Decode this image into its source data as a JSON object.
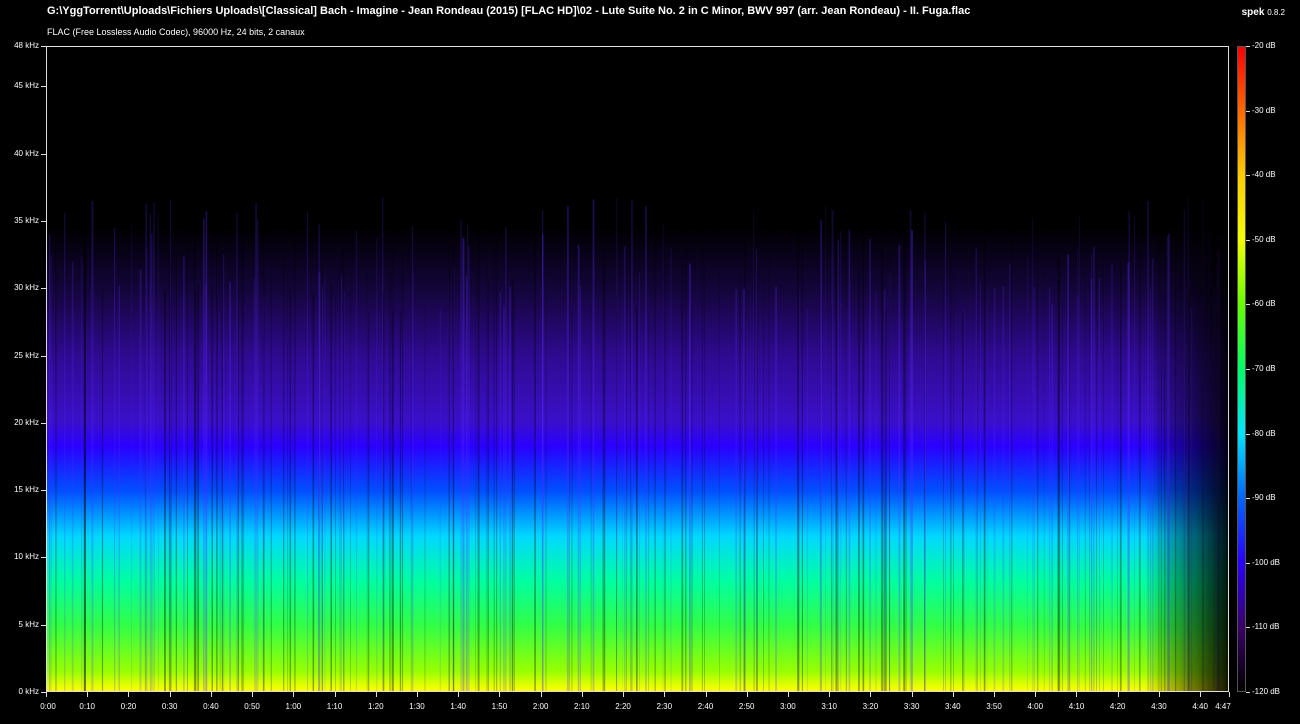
{
  "window": {
    "title": "G:\\YggTorrent\\Uploads\\Fichiers Uploads\\[Classical] Bach - Imagine - Jean Rondeau (2015) [FLAC HD]\\02 - Lute Suite No. 2 in C Minor, BWV 997 (arr. Jean Rondeau) - II. Fuga.flac",
    "subtitle": "FLAC (Free Lossless Audio Codec), 96000 Hz, 24 bits, 2 canaux",
    "app_name": "spek",
    "app_version": "0.8.2"
  },
  "freq_axis": {
    "labels": [
      "48 kHz",
      "45 kHz",
      "40 kHz",
      "35 kHz",
      "30 kHz",
      "25 kHz",
      "20 kHz",
      "15 kHz",
      "10 kHz",
      "5 kHz",
      "0 kHz"
    ],
    "values_khz": [
      48,
      45,
      40,
      35,
      30,
      25,
      20,
      15,
      10,
      5,
      0
    ],
    "max_khz": 48
  },
  "time_axis": {
    "labels": [
      "0:00",
      "0:10",
      "0:20",
      "0:30",
      "0:40",
      "0:50",
      "1:00",
      "1:10",
      "1:20",
      "1:30",
      "1:40",
      "1:50",
      "2:00",
      "2:10",
      "2:20",
      "2:30",
      "2:40",
      "2:50",
      "3:00",
      "3:10",
      "3:20",
      "3:30",
      "3:40",
      "3:50",
      "4:00",
      "4:10",
      "4:20",
      "4:30",
      "4:40",
      "4:47"
    ],
    "values_sec": [
      0,
      10,
      20,
      30,
      40,
      50,
      60,
      70,
      80,
      90,
      100,
      110,
      120,
      130,
      140,
      150,
      160,
      170,
      180,
      190,
      200,
      210,
      220,
      230,
      240,
      250,
      260,
      270,
      280,
      287
    ],
    "duration_sec": 287
  },
  "db_scale": {
    "labels": [
      "-20 dB",
      "-30 dB",
      "-40 dB",
      "-50 dB",
      "-60 dB",
      "-70 dB",
      "-80 dB",
      "-90 dB",
      "-100 dB",
      "-110 dB",
      "-120 dB"
    ],
    "values_db": [
      -20,
      -30,
      -40,
      -50,
      -60,
      -70,
      -80,
      -90,
      -100,
      -110,
      -120
    ],
    "colors": [
      "#ff0000",
      "#ff6a00",
      "#ffcc00",
      "#f2ff00",
      "#66ff00",
      "#00ff66",
      "#00e5ff",
      "#0066ff",
      "#2a00ff",
      "#3a0066",
      "#000000"
    ]
  }
}
